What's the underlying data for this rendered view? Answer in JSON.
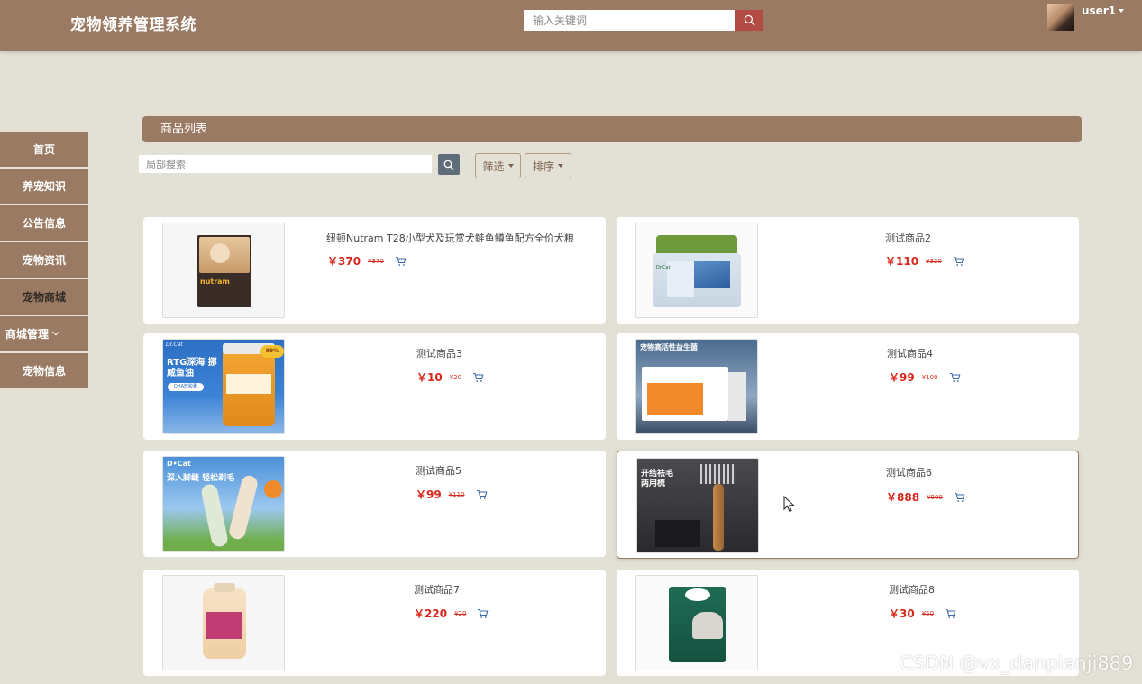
{
  "header": {
    "title": "宠物领养管理系统",
    "search_placeholder": "输入关键词",
    "username": "user1"
  },
  "sidebar": {
    "items": [
      {
        "label": "首页"
      },
      {
        "label": "养宠知识"
      },
      {
        "label": "公告信息"
      },
      {
        "label": "宠物资讯"
      },
      {
        "label": "宠物商城",
        "active": true
      },
      {
        "label": "商城管理",
        "has_dropdown": true
      },
      {
        "label": "宠物信息"
      }
    ]
  },
  "main": {
    "section_title": "商品列表",
    "local_search_placeholder": "局部搜索",
    "filter_label": "筛选",
    "sort_label": "排序"
  },
  "products": [
    {
      "name": "纽顿Nutram T28小型犬及玩赏犬鲑鱼鳟鱼配方全价犬粮",
      "price": "￥370",
      "old_price": "¥370",
      "thumb_brand": "nutram"
    },
    {
      "name": "测试商品2",
      "price": "￥110",
      "old_price": "¥320",
      "thumb_text": "Dr.Cat"
    },
    {
      "name": "测试商品3",
      "price": "￥10",
      "old_price": "¥20",
      "thumb_text": "RTG深海 挪威鱼油",
      "thumb_sub": "DHA软胶囊",
      "thumb_brand": "Dr.Cat",
      "thumb_badge": "99%"
    },
    {
      "name": "测试商品4",
      "price": "￥99",
      "old_price": "¥100",
      "thumb_text": "宠物高活性益生菌"
    },
    {
      "name": "测试商品5",
      "price": "￥99",
      "old_price": "¥110",
      "thumb_text": "深入脚缝 轻松剃毛",
      "thumb_brand": "D•Cat"
    },
    {
      "name": "测试商品6",
      "price": "￥888",
      "old_price": "¥900",
      "thumb_text": "开结祛毛 两用梳"
    },
    {
      "name": "测试商品7",
      "price": "￥220",
      "old_price": "¥20"
    },
    {
      "name": "测试商品8",
      "price": "￥30",
      "old_price": "¥50"
    }
  ],
  "watermark": "CSDN @vx_danpianji889",
  "colors": {
    "header_bg": "#9a7a63",
    "page_bg": "#e3e0d5",
    "price_red": "#d8281c",
    "search_button": "#b34b45",
    "local_search_button": "#5f6d7b"
  }
}
